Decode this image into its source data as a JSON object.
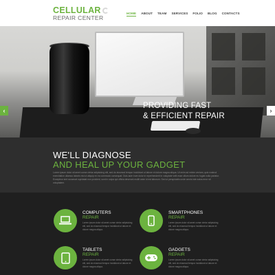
{
  "logo": {
    "title": "CELLULAR",
    "subtitle": "REPAIR CENTER"
  },
  "nav": [
    "HOME",
    "ABOUT",
    "TEAM",
    "SERVICES",
    "FOLIO",
    "BLOG",
    "CONTACTS"
  ],
  "hero": {
    "line1": "PROVIDING FAST",
    "line2": "& EFFICIENT REPAIR",
    "prev": "‹",
    "next": "›"
  },
  "diagnose": {
    "heading1": "WE'LL DIAGNOSE",
    "heading2": "AND HEAL UP YOUR GADGET",
    "text": "Lorem ipsum dolor sit amet conse ctetur adipisicing elit, sed do eiusmod tempor incididunt ut labore et dolore magna aliqua. Ut enim ad minim veniam, quis nostrud exercitation ullamco laboris nisi ut aliquip ex ea commodo consequat. Duis aute irure dolor in reprehenderit in voluptate velit esse cillum dolore eu fugiat nulla pariatur. Excepteur sint occaecat cupidatat non proident, sunt in culpa qui officia deserunt mollit anim id est laborum. Sed ut perspiciatis unde omnis iste natus error sit voluptatem."
  },
  "services": [
    {
      "title": "COMPUTERS",
      "sub": "REPAIR",
      "icon": "laptop-icon",
      "text": "Lorem ipsum dolor sit amet conse ctetur adipisicing elit, sed do eiusmod tempor incididunt ut labore et dolore magna aliqua."
    },
    {
      "title": "SMARTPHONES",
      "sub": "REPAIR",
      "icon": "smartphone-icon",
      "text": "Lorem ipsum dolor sit amet conse ctetur adipisicing elit, sed do eiusmod tempor incididunt ut labore et dolore magna aliqua."
    },
    {
      "title": "TABLETS",
      "sub": "REPAIR",
      "icon": "tablet-icon",
      "text": "Lorem ipsum dolor sit amet conse ctetur adipisicing elit, sed do eiusmod tempor incididunt ut labore et dolore magna aliqua."
    },
    {
      "title": "GADGETS",
      "sub": "REPAIR",
      "icon": "gamepad-icon",
      "text": "Lorem ipsum dolor sit amet conse ctetur adipisicing elit, sed do eiusmod tempor incididunt ut labore et dolore magna aliqua."
    }
  ],
  "colors": {
    "accent": "#6cb33f",
    "dark": "#1f1f1f",
    "section": "#2e2e2e"
  }
}
